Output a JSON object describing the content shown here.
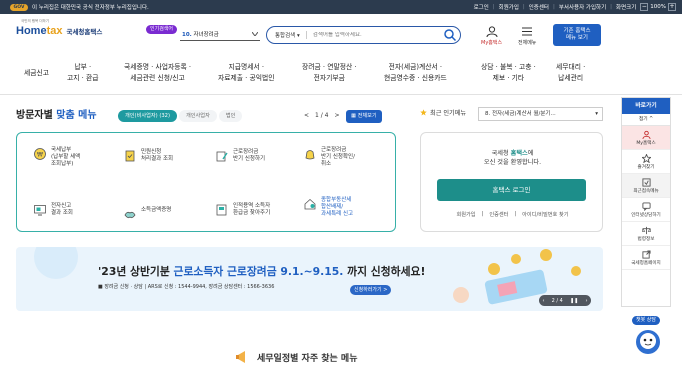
{
  "top_bar": {
    "gov_mark": "GOV",
    "notice": "이 누리집은 대한민국 공식 전자정부 누리집입니다.",
    "links": [
      "로그인",
      "회원가입",
      "인증센터",
      "부서사용자 가입하기",
      "화면크기"
    ],
    "zoom": "100%"
  },
  "header": {
    "logo_tag": "국민의 행복 더하기",
    "logo_text_a": "Home",
    "logo_text_b": "tax",
    "logo_sub": "국세청홈택스",
    "popular_tag": "인기검색어",
    "popular_num": "10.",
    "popular_term": "자녀장려금",
    "search_select": "통합검색",
    "search_placeholder": "검색어를 입력하세요.",
    "mytax_label": "My홈택스",
    "allmenu_label": "전체메뉴",
    "cta_line1": "기존 홈택스",
    "cta_line2": "메뉴 보기"
  },
  "gnb": [
    [
      "세금신고"
    ],
    [
      "납부 ·",
      "고지 · 환급"
    ],
    [
      "국세증명 · 사업자등록 ·",
      "세금관련 신청/신고"
    ],
    [
      "지급명세서 ·",
      "자료제출 · 공익법인"
    ],
    [
      "장려금 · 연말정산 ·",
      "전자기부금"
    ],
    [
      "전자(세금)계산서 ·",
      "현금영수증 · 신용카드"
    ],
    [
      "상담 · 불복 · 고충 ·",
      "제보 · 기타"
    ],
    [
      "세무대리 ·",
      "납세관리"
    ]
  ],
  "visit": {
    "title_a": "방문자별",
    "title_b": "맞춤 메뉴"
  },
  "tabs": [
    "개인(비사업자) (32)",
    "개인사업자",
    "법인"
  ],
  "pager": {
    "prev": "<",
    "text": "1 / 4",
    "next": ">"
  },
  "view_all": "전체보기",
  "quick": [
    [
      "국세납부",
      "(납부할 세액",
      "조회납부)"
    ],
    [
      "민원신청",
      "처리결과 조회"
    ],
    [
      "근로장려금",
      "반기 신청하기"
    ],
    [
      "근로장려금",
      "반기 신청확인/",
      "취소"
    ],
    [
      "전자신고",
      "결과 조회"
    ],
    [
      "소득금액증명"
    ],
    [
      "인적용역 소득자",
      "환급금 찾아주기"
    ],
    [
      "종합부동산세",
      "합산배제/",
      "과세특례 신고"
    ]
  ],
  "fav": {
    "label": "최근 인기메뉴",
    "selected": "8. 전자(세금)계산서 월/분기..."
  },
  "login": {
    "welcome_a": "국세청",
    "welcome_brand": "홈택스",
    "welcome_b": "에",
    "welcome_c": "오신 것을 환영합니다.",
    "button": "홈택스 로그인",
    "links": [
      "회원가입",
      "인증센터",
      "아이디/비밀번호 찾기"
    ]
  },
  "banner": {
    "title_a": "'23년 상반기분",
    "title_hl": "근로소득자 근로장려금 9.1.~9.15.",
    "title_b": "까지 신청하세요!",
    "sub": "■ 장려금 신청 · 상담  |  ARS로 신청 : 1544-9944, 장려금 상담센터 : 1566-3636",
    "button": "신청하러가기 >",
    "pager": "2 / 4"
  },
  "schedule": "세무일정별 자주 찾는 메뉴",
  "side": {
    "head": "바로가기",
    "close": "접기 ^",
    "items": [
      "My홈택스",
      "즐겨찾기",
      "최근접속메뉴",
      "인터넷상담하기",
      "법령정보",
      "국세청홈페이지"
    ]
  },
  "chatbot": "챗봇 상담",
  "colors": {
    "brand": "#1f5fc1",
    "teal": "#1d8e8a",
    "topbar": "#2c3b4e"
  }
}
